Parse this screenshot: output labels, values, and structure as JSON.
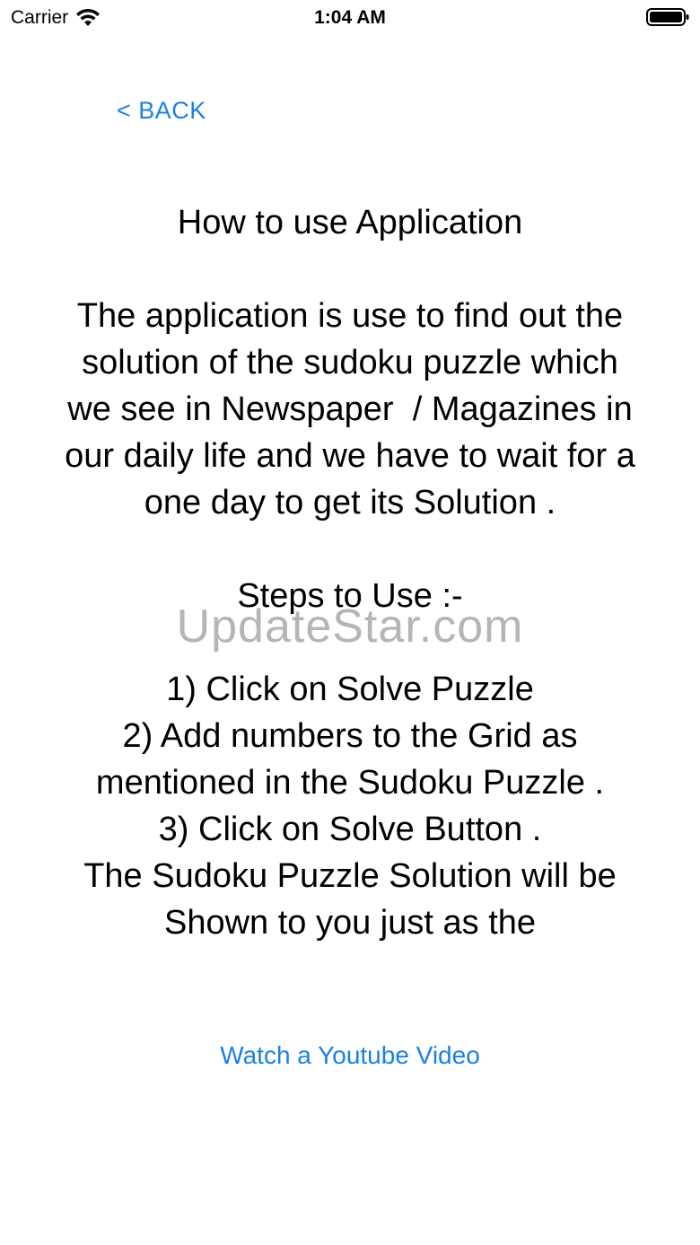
{
  "status_bar": {
    "carrier": "Carrier",
    "time": "1:04 AM"
  },
  "nav": {
    "back_label": "< BACK"
  },
  "content": {
    "text": "How to use Application\n\nThe application is use to find out the solution of the sudoku puzzle which we see in Newspaper  / Magazines in our daily life and we have to wait for a one day to get its Solution .\n\nSteps to Use :-\n\n1) Click on Solve Puzzle\n2) Add numbers to the Grid as mentioned in the Sudoku Puzzle .\n3) Click on Solve Button .\nThe Sudoku Puzzle Solution will be Shown to you just as the"
  },
  "watermark": "UpdateStar.com",
  "links": {
    "youtube_label": "Watch a Youtube Video"
  },
  "colors": {
    "link": "#1a80e6"
  }
}
